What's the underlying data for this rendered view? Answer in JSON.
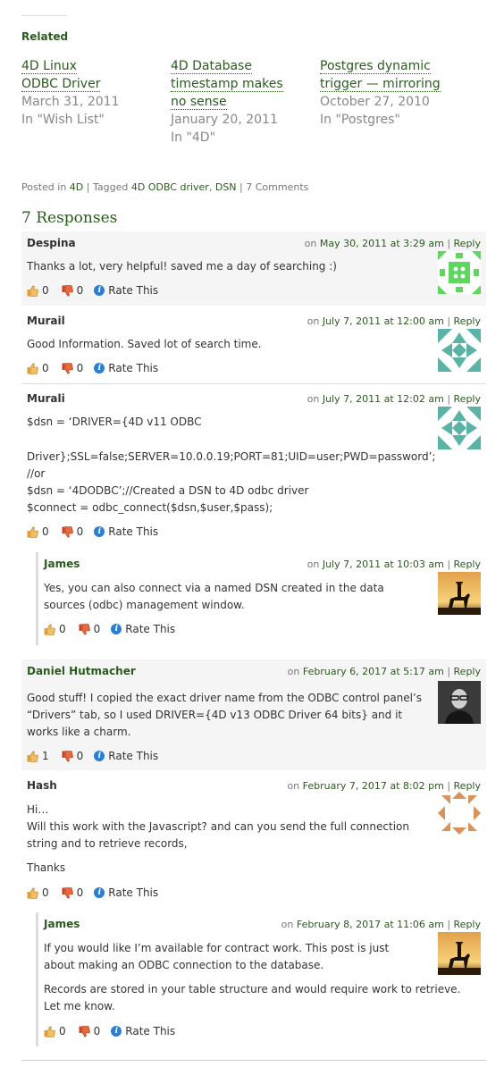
{
  "related": {
    "heading": "Related",
    "items": [
      {
        "title_l1": "4D Linux",
        "title_l2": "ODBC Driver",
        "title_l3": "",
        "date": "March 31, 2011",
        "category": "In \"Wish List\""
      },
      {
        "title_l1": "4D Database",
        "title_l2": "timestamp makes",
        "title_l3": "no sense",
        "date": "January 20, 2011",
        "category": "In \"4D\""
      },
      {
        "title_l1": "Postgres dynamic",
        "title_l2": "trigger — mirroring",
        "title_l3": "",
        "date": "October 27, 2010",
        "category": "In \"Postgres\""
      }
    ]
  },
  "postmeta": {
    "posted_in": "Posted in",
    "category": "4D",
    "sep1": "|",
    "tagged": "Tagged",
    "tag1": "4D ODBC driver",
    "tag2": "DSN",
    "sep2": "|",
    "comments": "7 Comments"
  },
  "responses_heading": "7 Responses",
  "ui": {
    "on": "on",
    "reply": "Reply",
    "rate_this": "Rate This",
    "sep": "|"
  },
  "comments": [
    {
      "author": "Despina",
      "date": "May 30, 2011 at 3:29 am",
      "lines": [
        "Thanks a lot, very helpful! saved me a day of searching :)"
      ],
      "up": "0",
      "down": "0"
    },
    {
      "author": "Murail",
      "date": "July 7, 2011 at 12:00 am",
      "lines": [
        "Good Information. Saved lot of search time."
      ],
      "up": "0",
      "down": "0"
    },
    {
      "author": "Murali",
      "date": "July 7, 2011 at 12:02 am",
      "lines": [
        "$dsn = ‘DRIVER={4D v11 ODBC",
        "Driver};SSL=false;SERVER=10.0.0.19;PORT=81;UID=user;PWD=password’;",
        "//or",
        "$dsn = ‘4DODBC’;//Created a DSN to 4D odbc driver",
        "$connect = odbc_connect($dsn,$user,$pass);"
      ],
      "up": "0",
      "down": "0"
    },
    {
      "author": "James",
      "date": "July 7, 2011 at 10:03 am",
      "lines": [
        "Yes, you can also connect via a named DSN created in the data",
        "sources (odbc) management window."
      ],
      "up": "0",
      "down": "0"
    },
    {
      "author": "Daniel Hutmacher",
      "date": "February 6, 2017 at 5:17 am",
      "lines": [
        "Good stuff! I copied the exact driver name from the ODBC control panel’s",
        "“Drivers” tab, so I used DRIVER={4D v13 ODBC Driver 64 bits} and it",
        "works like a charm."
      ],
      "up": "1",
      "down": "0"
    },
    {
      "author": "Hash",
      "date": "February 7, 2017 at 8:02 pm",
      "lines": [
        "Hi…",
        "Will this work with the Javascript? and can you send the full connection",
        "string and to retrieve records,",
        "Thanks"
      ],
      "up": "0",
      "down": "0"
    },
    {
      "author": "James",
      "date": "February 8, 2017 at 11:06 am",
      "lines": [
        "If you would like I’m available for contract work. This post is just",
        "about making an ODBC connection to the database.",
        "Records are stored in your table structure and would require work to retrieve.",
        "Let me know."
      ],
      "up": "0",
      "down": "0"
    }
  ],
  "colors": {
    "link": "#2b5a1e",
    "thumb_up": "#e0a030",
    "thumb_down": "#d04020",
    "info": "#2a7fd4"
  }
}
